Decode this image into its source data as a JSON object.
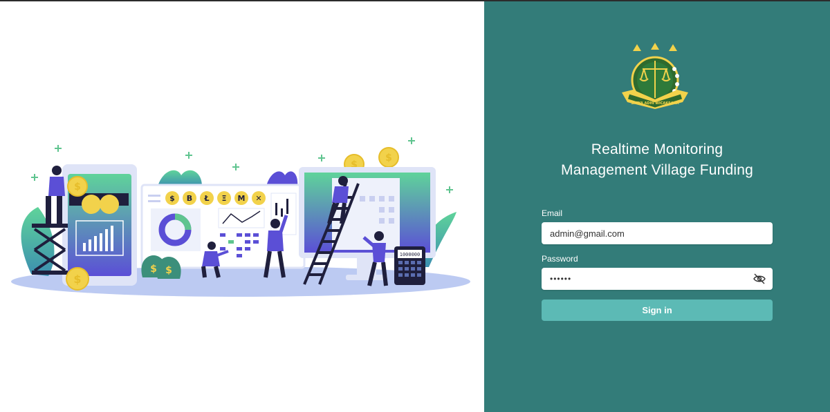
{
  "app": {
    "title_line1": "Realtime Monitoring",
    "title_line2": "Management Village Funding",
    "logo_text": "SATYA ADHI WICAKSANA"
  },
  "illustration": {
    "icon": "finance-team-illustration",
    "calculator_display": "1000000",
    "coin_symbols": [
      "$",
      "B",
      "Ł",
      "Ξ",
      "M",
      "✕"
    ]
  },
  "login": {
    "email_label": "Email",
    "email_value": "admin@gmail.com",
    "password_label": "Password",
    "password_value": "••••••",
    "toggle_icon": "eye-off-icon",
    "submit_label": "Sign in"
  },
  "colors": {
    "panel": "#337c79",
    "button": "#5cbab5",
    "illustration_purple": "#5b4fd6",
    "illustration_green": "#5fc48f",
    "coin_gold": "#f2d24b"
  }
}
